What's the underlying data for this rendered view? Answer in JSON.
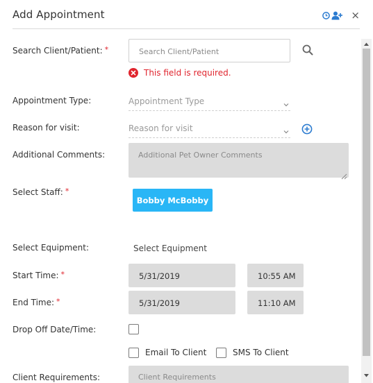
{
  "dialog": {
    "title": "Add Appointment",
    "header_icons": [
      "clock-icon",
      "add-user-icon",
      "close-icon"
    ],
    "close_glyph": "×"
  },
  "form": {
    "search": {
      "label": "Search Client/Patient:",
      "required_mark": "*",
      "placeholder": "Search Client/Patient",
      "error": "This field is required."
    },
    "appointment_type": {
      "label": "Appointment Type:",
      "value": "Appointment Type"
    },
    "reason": {
      "label": "Reason for visit:",
      "value": "Reason for visit"
    },
    "comments": {
      "label": "Additional Comments:",
      "placeholder": "Additional Pet Owner Comments"
    },
    "staff": {
      "label": "Select Staff:",
      "required_mark": "*",
      "selected": "Bobby McBobby"
    },
    "equipment": {
      "label": "Select Equipment:",
      "value": "Select Equipment"
    },
    "start_time": {
      "label": "Start Time:",
      "required_mark": "*",
      "date": "5/31/2019",
      "time": "10:55 AM"
    },
    "end_time": {
      "label": "End Time:",
      "required_mark": "*",
      "date": "5/31/2019",
      "time": "11:10 AM"
    },
    "drop_off": {
      "label": "Drop Off Date/Time:",
      "checked": false
    },
    "notify": {
      "email_label": "Email To Client",
      "email_checked": false,
      "sms_label": "SMS To Client",
      "sms_checked": false
    },
    "requirements": {
      "label": "Client Requirements:",
      "placeholder": "Client Requirements"
    }
  },
  "colors": {
    "accent": "#2b7bd0",
    "error": "#e0252e",
    "staff_button": "#29b6f6"
  }
}
